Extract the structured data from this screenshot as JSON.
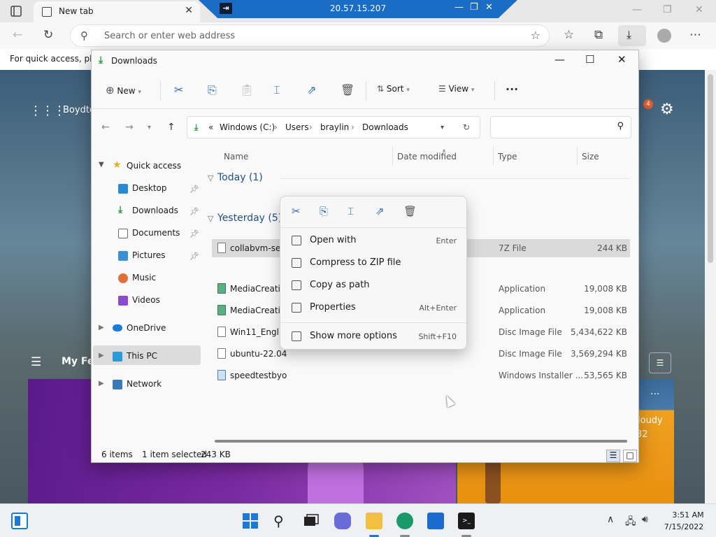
{
  "browser": {
    "tab_title": "New tab",
    "tab_close": "✕",
    "address_placeholder": "Search or enter web address",
    "favbar_text": "For quick access, plac",
    "window_controls": [
      "—",
      "❐",
      "✕"
    ]
  },
  "rdp": {
    "pin": "⇥",
    "ip": "20.57.15.207",
    "buttons": [
      "—",
      "❐",
      "✕"
    ]
  },
  "newtab": {
    "user_label": "Boydto",
    "badge_count": "4",
    "feed_title": "My Fe",
    "weather_more": "···",
    "weather_condition": "loudy",
    "weather_temp": "32"
  },
  "explorer": {
    "title": "Downloads",
    "commands": {
      "new": "New",
      "sort": "Sort",
      "view": "View",
      "more": "···"
    },
    "breadcrumb": [
      "Windows (C:)",
      "Users",
      "braylin",
      "Downloads"
    ],
    "breadcrumb_overflow": "«",
    "sidebar": [
      {
        "label": "Quick access"
      },
      {
        "label": "Desktop"
      },
      {
        "label": "Downloads"
      },
      {
        "label": "Documents"
      },
      {
        "label": "Pictures"
      },
      {
        "label": "Music"
      },
      {
        "label": "Videos"
      },
      {
        "label": "OneDrive"
      },
      {
        "label": "This PC"
      },
      {
        "label": "Network"
      }
    ],
    "columns": [
      "Name",
      "Date modified",
      "Type",
      "Size"
    ],
    "groups": [
      {
        "label": "Today (1)"
      },
      {
        "label": "Yesterday (5)"
      }
    ],
    "files": [
      {
        "name": "collabvm-setu",
        "type": "7Z File",
        "size": "244 KB"
      },
      {
        "name": "MediaCreatio",
        "type": "Application",
        "size": "19,008 KB"
      },
      {
        "name": "MediaCreatio",
        "type": "Application",
        "size": "19,008 KB"
      },
      {
        "name": "Win11_Englisl",
        "type": "Disc Image File",
        "size": "5,434,622 KB"
      },
      {
        "name": "ubuntu-22.04",
        "type": "Disc Image File",
        "size": "3,569,294 KB"
      },
      {
        "name": "speedtestbyo",
        "type": "Windows Installer ...",
        "size": "53,565 KB"
      }
    ],
    "status": {
      "items": "6 items",
      "selected": "1 item selected",
      "size": "243 KB"
    }
  },
  "context_menu": {
    "items": [
      {
        "label": "Open with",
        "shortcut": "Enter"
      },
      {
        "label": "Compress to ZIP file",
        "shortcut": ""
      },
      {
        "label": "Copy as path",
        "shortcut": ""
      },
      {
        "label": "Properties",
        "shortcut": "Alt+Enter"
      },
      {
        "label": "Show more options",
        "shortcut": "Shift+F10"
      }
    ]
  },
  "taskbar": {
    "time": "3:51 AM",
    "date": "7/15/2022"
  },
  "colors": {
    "accent": "#2a6cb0",
    "rdp_bar": "#1a6cc4",
    "downloads_green": "#2a9a4a"
  }
}
